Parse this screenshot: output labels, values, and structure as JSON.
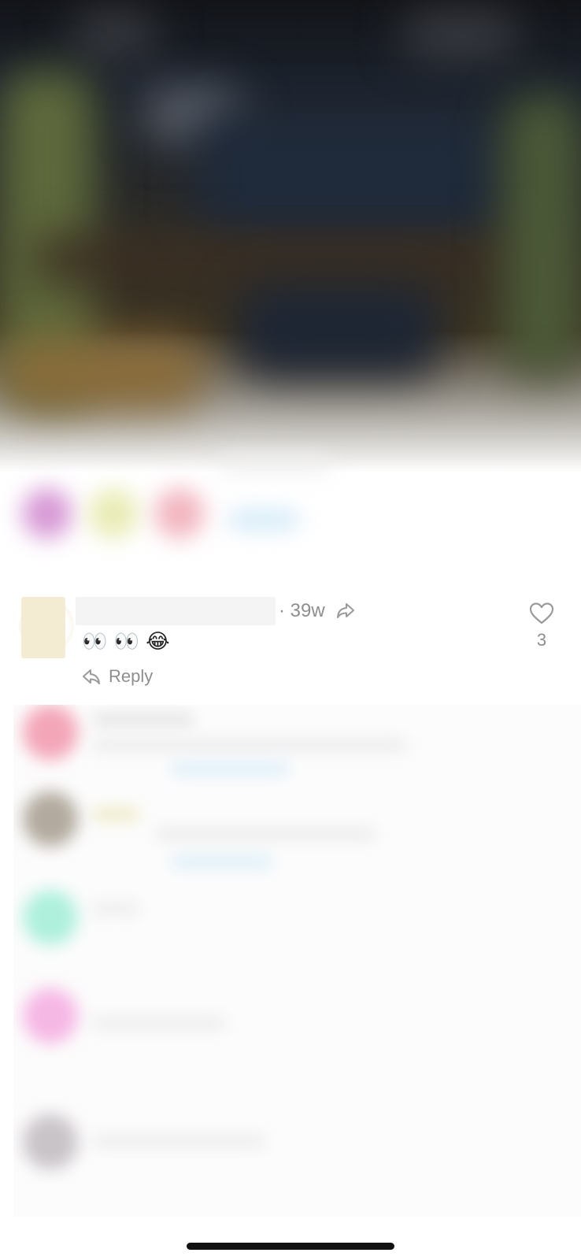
{
  "comment": {
    "time": "· 39w",
    "text": "👀 👀 😂",
    "reply_label": "Reply",
    "like_count": "3"
  },
  "icons": {
    "share": "share-arrow-icon",
    "reply": "reply-arrow-icon",
    "like": "heart-outline-icon"
  },
  "colors": {
    "muted_text": "#8e8e8e",
    "placeholder": "#f4f4f4",
    "avatar": "#f3ecd2",
    "home_indicator": "#111111"
  }
}
